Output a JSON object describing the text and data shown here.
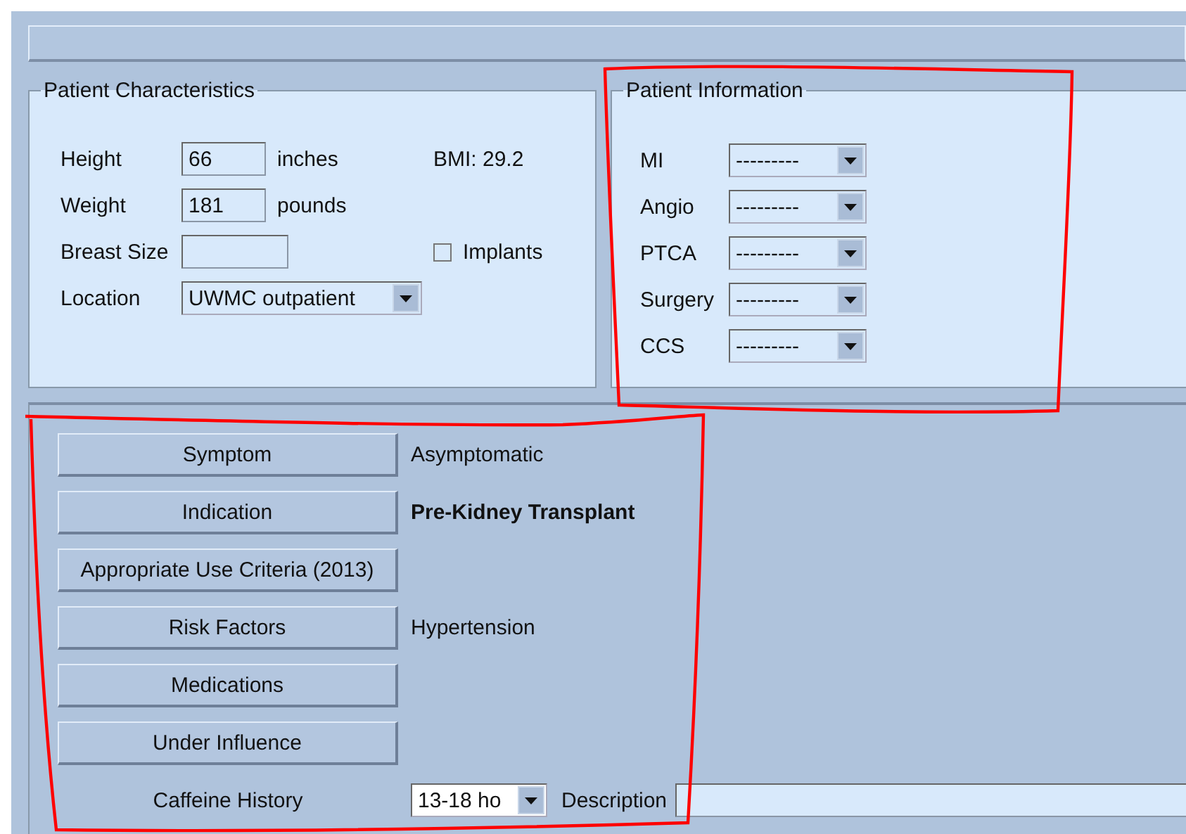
{
  "patient_characteristics": {
    "title": "Patient Characteristics",
    "height": {
      "label": "Height",
      "value": "66",
      "unit": "inches"
    },
    "bmi": "BMI: 29.2",
    "weight": {
      "label": "Weight",
      "value": "181",
      "unit": "pounds"
    },
    "breast_size": {
      "label": "Breast Size"
    },
    "implants": {
      "label": "Implants",
      "checked": false
    },
    "location": {
      "label": "Location",
      "value": "UWMC outpatient"
    }
  },
  "patient_information": {
    "title": "Patient Information",
    "fields": [
      {
        "label": "MI",
        "value": "---------"
      },
      {
        "label": "Angio",
        "value": "---------"
      },
      {
        "label": "PTCA",
        "value": "---------"
      },
      {
        "label": "Surgery",
        "value": "---------"
      },
      {
        "label": "CCS",
        "value": "---------"
      }
    ]
  },
  "history": {
    "rows": [
      {
        "button": "Symptom",
        "value": "Asymptomatic",
        "emphasis": false
      },
      {
        "button": "Indication",
        "value": "Pre-Kidney Transplant",
        "emphasis": true
      },
      {
        "button": "Appropriate Use Criteria (2013)"
      },
      {
        "button": "Risk Factors",
        "value": "Hypertension",
        "emphasis": false
      },
      {
        "button": "Medications"
      },
      {
        "button": "Under Influence"
      }
    ],
    "caffeine": {
      "label": "Caffeine History",
      "value": "13-18 ho",
      "description_label": "Description"
    }
  },
  "annotations": [
    {
      "kind": "outline",
      "color": "#ff0000"
    },
    {
      "kind": "outline",
      "color": "#ff0000"
    }
  ]
}
